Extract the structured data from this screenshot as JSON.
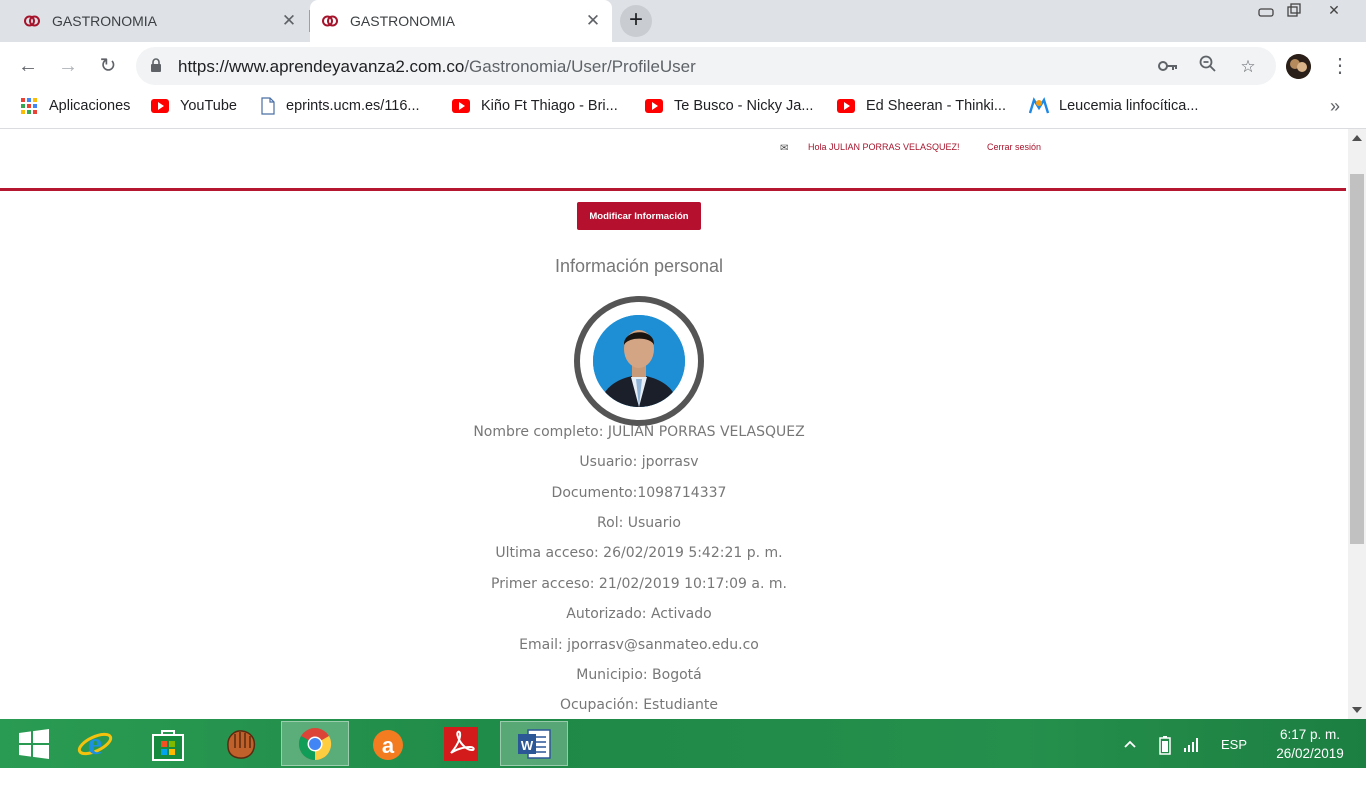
{
  "browser": {
    "tabs": [
      {
        "title": "GASTRONOMIA",
        "active": false
      },
      {
        "title": "GASTRONOMIA",
        "active": true
      }
    ],
    "url_host": "https://www.aprendeyavanza2.com.co",
    "url_path": "/Gastronomia/User/ProfileUser",
    "bookmarks": [
      {
        "label": "Aplicaciones",
        "icon": "apps-grid-icon"
      },
      {
        "label": "YouTube",
        "icon": "youtube-icon"
      },
      {
        "label": "eprints.ucm.es/116...",
        "icon": "document-icon"
      },
      {
        "label": "Kiño Ft Thiago - Bri...",
        "icon": "youtube-icon"
      },
      {
        "label": "Te Busco - Nicky Ja...",
        "icon": "youtube-icon"
      },
      {
        "label": "Ed Sheeran - Thinki...",
        "icon": "youtube-icon"
      },
      {
        "label": "Leucemia linfocítica...",
        "icon": "site-icon"
      }
    ],
    "bookmarks_more": "»"
  },
  "header": {
    "greeting": "Hola JULIAN PORRAS VELASQUEZ!",
    "logout": "Cerrar sesión"
  },
  "profile": {
    "modify_button": "Modificar Información",
    "section_title": "Información personal",
    "lines": [
      "Nombre completo: JULIAN PORRAS VELASQUEZ",
      "Usuario: jporrasv",
      "Documento:1098714337",
      "Rol: Usuario",
      "Ultima acceso: 26/02/2019 5:42:21 p. m.",
      "Primer acceso: 21/02/2019 10:17:09 a. m.",
      "Autorizado: Activado",
      "Email: jporrasv@sanmateo.edu.co",
      "Municipio: Bogotá",
      "Ocupación: Estudiante"
    ]
  },
  "taskbar": {
    "language": "ESP",
    "time": "6:17 p. m.",
    "date": "26/02/2019"
  },
  "colors": {
    "brand_red": "#b5102e",
    "taskbar_green": "#2a9b52"
  }
}
